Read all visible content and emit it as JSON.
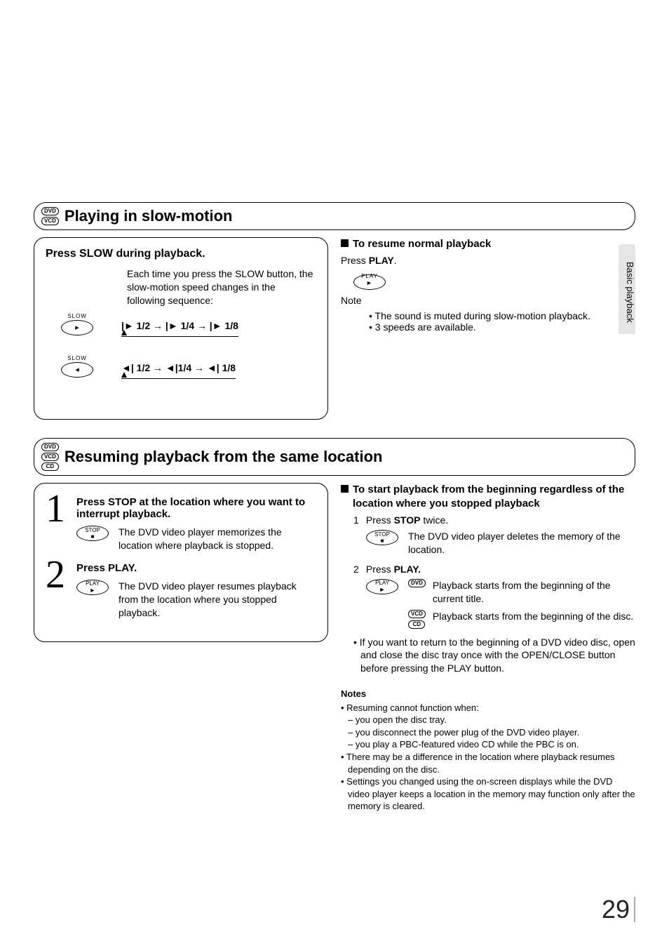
{
  "side_tab": "Basic playback",
  "section1": {
    "discs": [
      "DVD",
      "VCD"
    ],
    "title": "Playing in slow-motion",
    "box": {
      "heading": "Press SLOW during playback.",
      "desc": "Each time you press the SLOW button, the slow-motion speed changes in the following sequence:",
      "btn1_label": "SLOW",
      "seq1": "|► 1/2 → |► 1/4 → |► 1/8",
      "btn2_label": "SLOW",
      "seq2": "◄| 1/2 → ◄|1/4 → ◄| 1/8"
    },
    "right": {
      "sub_heading": "To resume normal playback",
      "sub_body_prefix": "Press ",
      "sub_body_bold": "PLAY",
      "sub_body_suffix": ".",
      "play_btn": "PLAY",
      "note_head": "Note",
      "note1": "• The sound is muted during slow-motion playback.",
      "note2": "• 3 speeds are available."
    }
  },
  "section2": {
    "discs": [
      "DVD",
      "VCD",
      "CD"
    ],
    "title": "Resuming playback from the same location",
    "box": {
      "step1_num": "1",
      "step1_head": "Press STOP at the location where you want to interrupt playback.",
      "step1_btn": "STOP",
      "step1_desc": "The DVD video player memorizes the location where playback is stopped.",
      "step2_num": "2",
      "step2_head": "Press PLAY.",
      "step2_btn": "PLAY",
      "step2_desc": "The DVD video player resumes playback from the location where you stopped playback."
    },
    "right": {
      "sub_heading": "To start playback from the beginning regardless of the location where you stopped playback",
      "li1_n": "1",
      "li1_prefix": "Press ",
      "li1_bold": "STOP",
      "li1_suffix": " twice.",
      "li1_btn": "STOP",
      "li1_desc": "The DVD video player deletes the memory of the location.",
      "li2_n": "2",
      "li2_prefix": "Press ",
      "li2_bold": "PLAY.",
      "li2_btn": "PLAY",
      "li2_pill1": "DVD",
      "li2_desc1": "Playback starts from the beginning of the current title.",
      "li2_pill2a": "VCD",
      "li2_pill2b": "CD",
      "li2_desc2": "Playback starts from the beginning of the disc.",
      "extra_bullet": "• If you want to return to the beginning of a DVD video disc, open and close the disc tray once with the OPEN/CLOSE button before pressing the PLAY button.",
      "notes_head": "Notes",
      "n1": "• Resuming cannot function when:",
      "n1a": "– you open the disc tray.",
      "n1b": "– you disconnect the power plug of the DVD video player.",
      "n1c": "– you play a PBC-featured video CD while the PBC is on.",
      "n2": "• There may be a difference in the location where playback resumes depending on the disc.",
      "n3": "• Settings you changed using the on-screen displays while the DVD video player keeps a location in the memory may function only after the memory is cleared."
    }
  },
  "page_number": "29"
}
